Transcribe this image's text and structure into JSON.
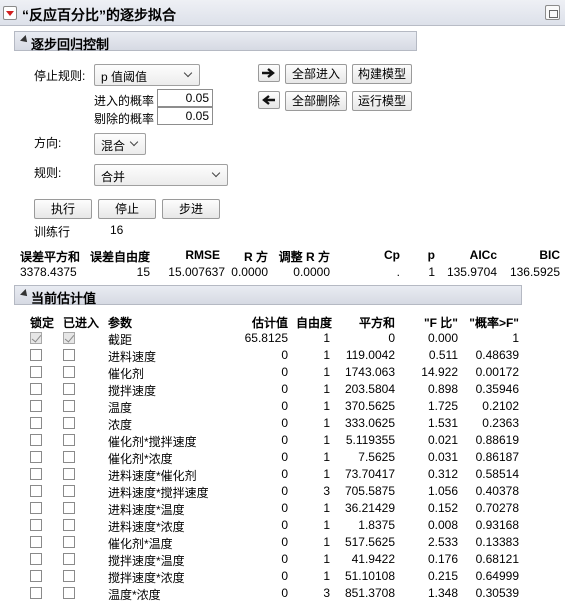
{
  "title": "“反应百分比”的逐步拟合",
  "control": {
    "section_title": "逐步回归控制",
    "stop_rule_label": "停止规则:",
    "stop_rule_value": "p 值阈值",
    "prob_enter_label": "进入的概率",
    "prob_enter_value": "0.05",
    "prob_leave_label": "剔除的概率",
    "prob_leave_value": "0.05",
    "direction_label": "方向:",
    "direction_value": "混合",
    "rules_label": "规则:",
    "rules_value": "合并",
    "enter_all": "全部进入",
    "remove_all": "全部删除",
    "make_model": "构建模型",
    "run_model": "运行模型",
    "go": "执行",
    "stop": "停止",
    "step": "步进",
    "train_rows_label": "训练行",
    "train_rows_value": "16"
  },
  "stats": {
    "headers": [
      "误差平方和",
      "误差自由度",
      "RMSE",
      "R 方",
      "调整 R 方",
      "Cp",
      "p",
      "AICc",
      "BIC"
    ],
    "values": [
      "3378.4375",
      "15",
      "15.007637",
      "0.0000",
      "0.0000",
      ".",
      "1",
      "135.9704",
      "136.5925"
    ]
  },
  "estimates": {
    "section_title": "当前估计值",
    "headers": {
      "lock": "锁定",
      "entered": "已进入",
      "param": "参数",
      "estimate": "估计值",
      "df": "自由度",
      "ss": "平方和",
      "f": "\"F 比\"",
      "p": "\"概率>F\""
    },
    "rows": [
      {
        "param": "截距",
        "estimate": "65.8125",
        "df": "1",
        "ss": "0",
        "f": "0.000",
        "p": "1",
        "lock": true,
        "entered": true
      },
      {
        "param": "进料速度",
        "estimate": "0",
        "df": "1",
        "ss": "119.0042",
        "f": "0.511",
        "p": "0.48639",
        "lock": false,
        "entered": false
      },
      {
        "param": "催化剂",
        "estimate": "0",
        "df": "1",
        "ss": "1743.063",
        "f": "14.922",
        "p": "0.00172",
        "lock": false,
        "entered": false
      },
      {
        "param": "搅拌速度",
        "estimate": "0",
        "df": "1",
        "ss": "203.5804",
        "f": "0.898",
        "p": "0.35946",
        "lock": false,
        "entered": false
      },
      {
        "param": "温度",
        "estimate": "0",
        "df": "1",
        "ss": "370.5625",
        "f": "1.725",
        "p": "0.2102",
        "lock": false,
        "entered": false
      },
      {
        "param": "浓度",
        "estimate": "0",
        "df": "1",
        "ss": "333.0625",
        "f": "1.531",
        "p": "0.2363",
        "lock": false,
        "entered": false
      },
      {
        "param": "催化剂*搅拌速度",
        "estimate": "0",
        "df": "1",
        "ss": "5.119355",
        "f": "0.021",
        "p": "0.88619",
        "lock": false,
        "entered": false
      },
      {
        "param": "催化剂*浓度",
        "estimate": "0",
        "df": "1",
        "ss": "7.5625",
        "f": "0.031",
        "p": "0.86187",
        "lock": false,
        "entered": false
      },
      {
        "param": "进料速度*催化剂",
        "estimate": "0",
        "df": "1",
        "ss": "73.70417",
        "f": "0.312",
        "p": "0.58514",
        "lock": false,
        "entered": false
      },
      {
        "param": "进料速度*搅拌速度",
        "estimate": "0",
        "df": "3",
        "ss": "705.5875",
        "f": "1.056",
        "p": "0.40378",
        "lock": false,
        "entered": false
      },
      {
        "param": "进料速度*温度",
        "estimate": "0",
        "df": "1",
        "ss": "36.21429",
        "f": "0.152",
        "p": "0.70278",
        "lock": false,
        "entered": false
      },
      {
        "param": "进料速度*浓度",
        "estimate": "0",
        "df": "1",
        "ss": "1.8375",
        "f": "0.008",
        "p": "0.93168",
        "lock": false,
        "entered": false
      },
      {
        "param": "催化剂*温度",
        "estimate": "0",
        "df": "1",
        "ss": "517.5625",
        "f": "2.533",
        "p": "0.13383",
        "lock": false,
        "entered": false
      },
      {
        "param": "搅拌速度*温度",
        "estimate": "0",
        "df": "1",
        "ss": "41.9422",
        "f": "0.176",
        "p": "0.68121",
        "lock": false,
        "entered": false
      },
      {
        "param": "搅拌速度*浓度",
        "estimate": "0",
        "df": "1",
        "ss": "51.10108",
        "f": "0.215",
        "p": "0.64999",
        "lock": false,
        "entered": false
      },
      {
        "param": "温度*浓度",
        "estimate": "0",
        "df": "3",
        "ss": "851.3708",
        "f": "1.348",
        "p": "0.30539",
        "lock": false,
        "entered": false
      }
    ]
  },
  "colors": {
    "red_triangle": "#d21f1f",
    "header_bg": "#dde1ea"
  }
}
